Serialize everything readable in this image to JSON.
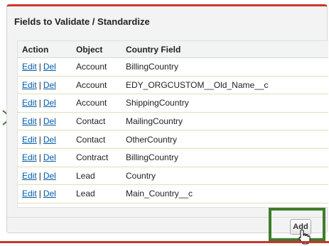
{
  "panel": {
    "title": "Fields to Validate / Standardize"
  },
  "table": {
    "headers": [
      "Action",
      "Object",
      "Country Field"
    ],
    "edit_label": "Edit",
    "separator": "|",
    "del_label": "Del",
    "rows": [
      {
        "object": "Account",
        "field": "BillingCountry"
      },
      {
        "object": "Account",
        "field": "EDY_ORGCUSTOM__Old_Name__c"
      },
      {
        "object": "Account",
        "field": "ShippingCountry"
      },
      {
        "object": "Contact",
        "field": "MailingCountry"
      },
      {
        "object": "Contact",
        "field": "OtherCountry"
      },
      {
        "object": "Contract",
        "field": "BillingCountry"
      },
      {
        "object": "Lead",
        "field": "Country"
      },
      {
        "object": "Lead",
        "field": "Main_Country__c"
      }
    ]
  },
  "footer": {
    "add_label": "Add"
  },
  "colors": {
    "accent_red": "#c8372e",
    "link_blue": "#015ba7",
    "highlight_green": "#3e7d2b",
    "arrow_green": "#3e7d2b"
  },
  "icons": [
    "arrow-right-icon",
    "hand-pointer-cursor-icon"
  ]
}
